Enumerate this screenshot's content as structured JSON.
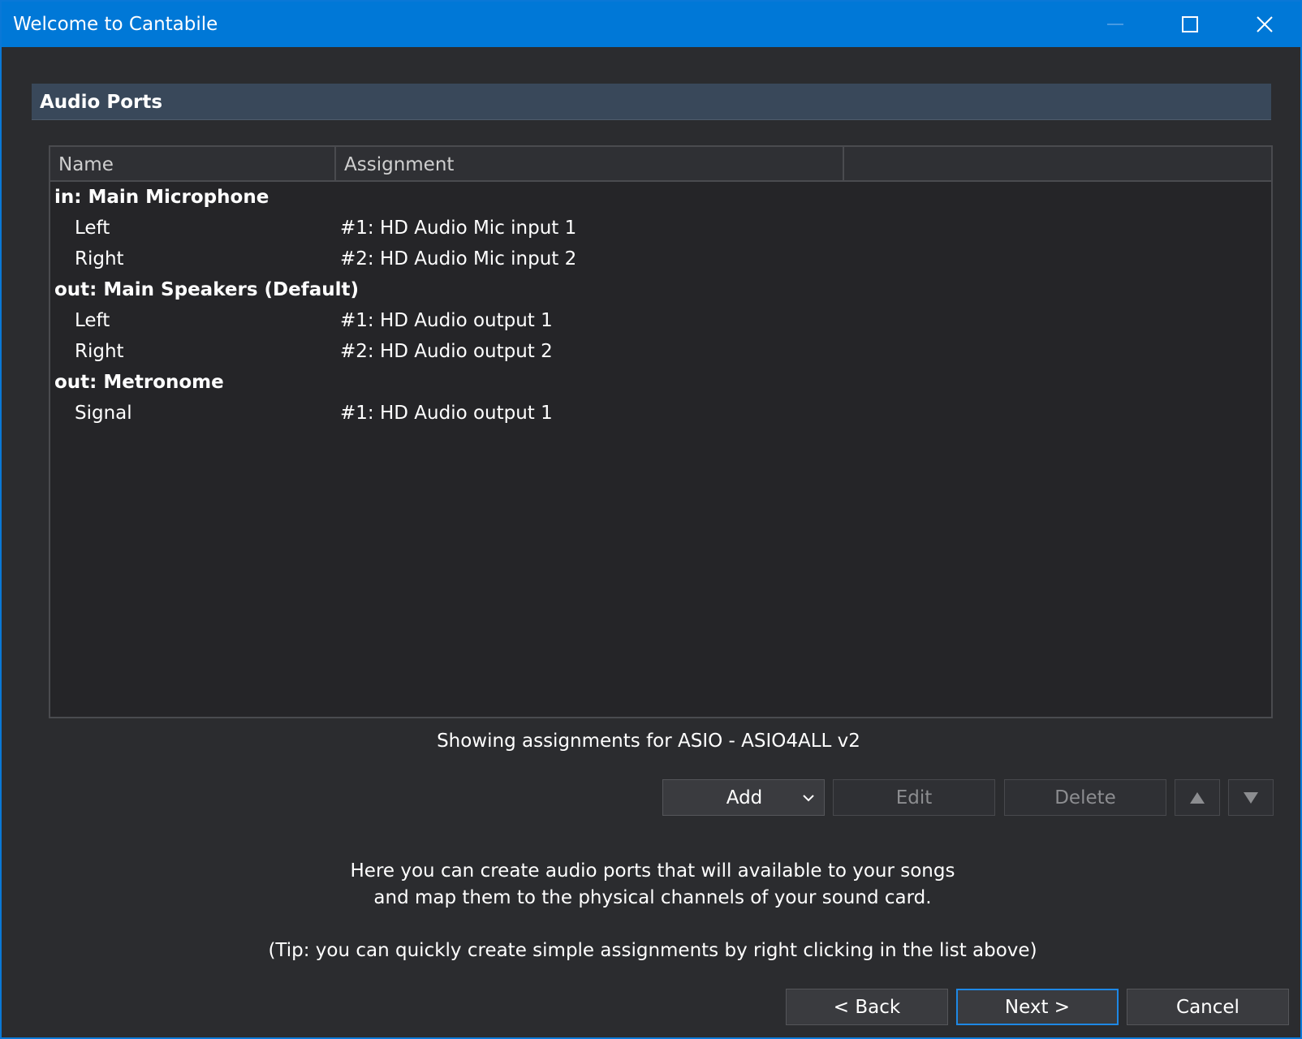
{
  "window": {
    "title": "Welcome to Cantabile",
    "controls": [
      "minimize-icon",
      "maximize-icon",
      "close-icon"
    ]
  },
  "section": {
    "title": "Audio Ports"
  },
  "list": {
    "columns": [
      "Name",
      "Assignment",
      ""
    ],
    "rows": [
      {
        "type": "group",
        "name": "in: Main Microphone",
        "assignment": ""
      },
      {
        "type": "channel",
        "name": "Left",
        "assignment": "#1: HD Audio Mic input 1"
      },
      {
        "type": "channel",
        "name": "Right",
        "assignment": "#2: HD Audio Mic input 2"
      },
      {
        "type": "group",
        "name": "out: Main Speakers (Default)",
        "assignment": ""
      },
      {
        "type": "channel",
        "name": "Left",
        "assignment": "#1: HD Audio output 1"
      },
      {
        "type": "channel",
        "name": "Right",
        "assignment": "#2: HD Audio output 2"
      },
      {
        "type": "group",
        "name": "out: Metronome",
        "assignment": ""
      },
      {
        "type": "channel",
        "name": "Signal",
        "assignment": "#1: HD Audio output 1"
      }
    ]
  },
  "status": {
    "text": "Showing assignments for ASIO - ASIO4ALL v2"
  },
  "toolbar": {
    "add_label": "Add",
    "edit_label": "Edit",
    "delete_label": "Delete",
    "up_icon": "triangle-up-icon",
    "down_icon": "triangle-down-icon"
  },
  "help": {
    "line1": "Here you can create audio ports that will available to your songs",
    "line2": "and map them to the physical channels of your sound card.",
    "tip": "(Tip: you can quickly create simple assignments by right clicking in the list above)"
  },
  "footer": {
    "back_label": "< Back",
    "next_label": "Next >",
    "cancel_label": "Cancel"
  },
  "colors": {
    "titlebar": "#0078d7",
    "background": "#2b2c2f",
    "section_header": "#39485a",
    "list_background": "#252528"
  }
}
